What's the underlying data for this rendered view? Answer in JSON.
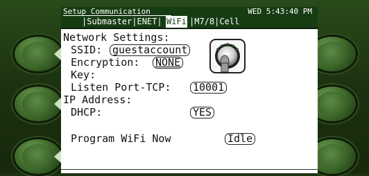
{
  "titlebar": {
    "title": "Setup Communication",
    "datetime": "WED 5:43:40 PM"
  },
  "tabs": [
    {
      "label": "|Submaster|ENET|",
      "active": false
    },
    {
      "label": "WiFi",
      "active": true
    },
    {
      "label": "|M7/8|Cell",
      "active": false
    }
  ],
  "network": {
    "section_label": "Network Settings:",
    "ssid_label": "SSID:",
    "ssid_value": "guestaccount",
    "encryption_label": "Encryption:",
    "encryption_value": "NONE",
    "key_label": "Key:",
    "listen_port_label": "Listen Port-TCP:",
    "listen_port_value": "10001"
  },
  "ip": {
    "section_label": "IP Address:",
    "dhcp_label": "DHCP:",
    "dhcp_value": "YES"
  },
  "program": {
    "label": "Program WiFi Now",
    "status": "Idle"
  },
  "icons": {
    "wheel": "scroll-wheel-icon",
    "side_buttons": "bezel-button"
  }
}
